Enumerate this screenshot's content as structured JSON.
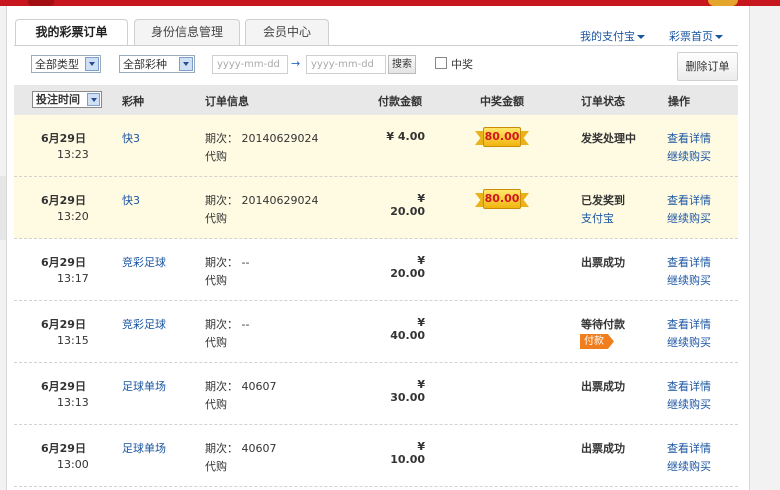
{
  "tabs": [
    {
      "label": "我的彩票订单"
    },
    {
      "label": "身份信息管理"
    },
    {
      "label": "会员中心"
    }
  ],
  "top_links": {
    "alipay": "我的支付宝",
    "lottery_home": "彩票首页"
  },
  "filters": {
    "type_select": "全部类型",
    "lottery_select": "全部彩种",
    "date_from_placeholder": "yyyy-mm-dd",
    "date_arrow": "→",
    "date_to_placeholder": "yyyy-mm-dd",
    "search_label": "搜索",
    "win_only_label": "中奖",
    "win_only_checked": false,
    "delete_label": "删除订单"
  },
  "table": {
    "sort_label": "投注时间",
    "headers": {
      "type": "彩种",
      "info": "订单信息",
      "amount": "付款金额",
      "prize": "中奖金额",
      "status": "订单状态",
      "action": "操作"
    },
    "rows": [
      {
        "date": "6月29日",
        "time": "13:23",
        "type": "快3",
        "issue": "期次： 20140629024",
        "mode": "代购",
        "amount": "¥ 4.00",
        "prize": "80.00",
        "status": "发奖处理中",
        "status_link": "",
        "pay_tag": "",
        "op_detail": "查看详情",
        "op_rebuy": "继续购买",
        "highlight": true
      },
      {
        "date": "6月29日",
        "time": "13:20",
        "type": "快3",
        "issue": "期次： 20140629024",
        "mode": "代购",
        "amount": "¥ 20.00",
        "prize": "80.00",
        "status": "已发奖到",
        "status_link": "支付宝",
        "pay_tag": "",
        "op_detail": "查看详情",
        "op_rebuy": "继续购买",
        "highlight": true
      },
      {
        "date": "6月29日",
        "time": "13:17",
        "type": "竞彩足球",
        "issue": "期次： --",
        "mode": "代购",
        "amount": "¥ 20.00",
        "prize": "",
        "status": "出票成功",
        "status_link": "",
        "pay_tag": "",
        "op_detail": "查看详情",
        "op_rebuy": "继续购买",
        "highlight": false
      },
      {
        "date": "6月29日",
        "time": "13:15",
        "type": "竞彩足球",
        "issue": "期次： --",
        "mode": "代购",
        "amount": "¥ 40.00",
        "prize": "",
        "status": "等待付款",
        "status_link": "",
        "pay_tag": "付款",
        "op_detail": "查看详情",
        "op_rebuy": "继续购买",
        "highlight": false
      },
      {
        "date": "6月29日",
        "time": "13:13",
        "type": "足球单场",
        "issue": "期次： 40607",
        "mode": "代购",
        "amount": "¥ 30.00",
        "prize": "",
        "status": "出票成功",
        "status_link": "",
        "pay_tag": "",
        "op_detail": "查看详情",
        "op_rebuy": "继续购买",
        "highlight": false
      },
      {
        "date": "6月29日",
        "time": "13:00",
        "type": "足球单场",
        "issue": "期次： 40607",
        "mode": "代购",
        "amount": "¥ 10.00",
        "prize": "",
        "status": "出票成功",
        "status_link": "",
        "pay_tag": "",
        "op_detail": "查看详情",
        "op_rebuy": "继续购买",
        "highlight": false
      }
    ]
  }
}
